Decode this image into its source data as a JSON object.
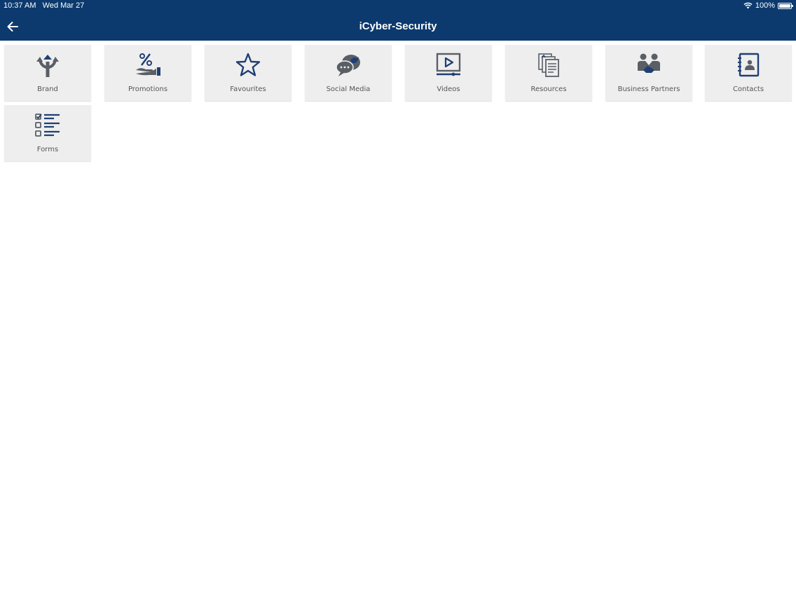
{
  "status_bar": {
    "time": "10:37 AM",
    "date": "Wed Mar 27",
    "battery": "100%",
    "battery_level": 1.0,
    "wifi_icon": "wifi-icon",
    "battery_icon": "battery-icon"
  },
  "nav": {
    "title": "iCyber-Security",
    "back_icon": "arrow-left-icon"
  },
  "colors": {
    "navbar": "#0c3a6e",
    "tile_bg": "#eeeeee",
    "icon_dark": "#5a5f66",
    "icon_blue": "#1f3f73",
    "label": "#555555"
  },
  "tiles": [
    {
      "label": "Brand",
      "icon": "signpost-arrows-icon"
    },
    {
      "label": "Promotions",
      "icon": "percent-hand-icon"
    },
    {
      "label": "Favourites",
      "icon": "star-icon"
    },
    {
      "label": "Social Media",
      "icon": "chat-bird-icon"
    },
    {
      "label": "Videos",
      "icon": "play-screen-icon"
    },
    {
      "label": "Resources",
      "icon": "documents-icon"
    },
    {
      "label": "Business Partners",
      "icon": "handshake-people-icon"
    },
    {
      "label": "Contacts",
      "icon": "address-book-icon"
    },
    {
      "label": "Forms",
      "icon": "checklist-icon"
    }
  ]
}
